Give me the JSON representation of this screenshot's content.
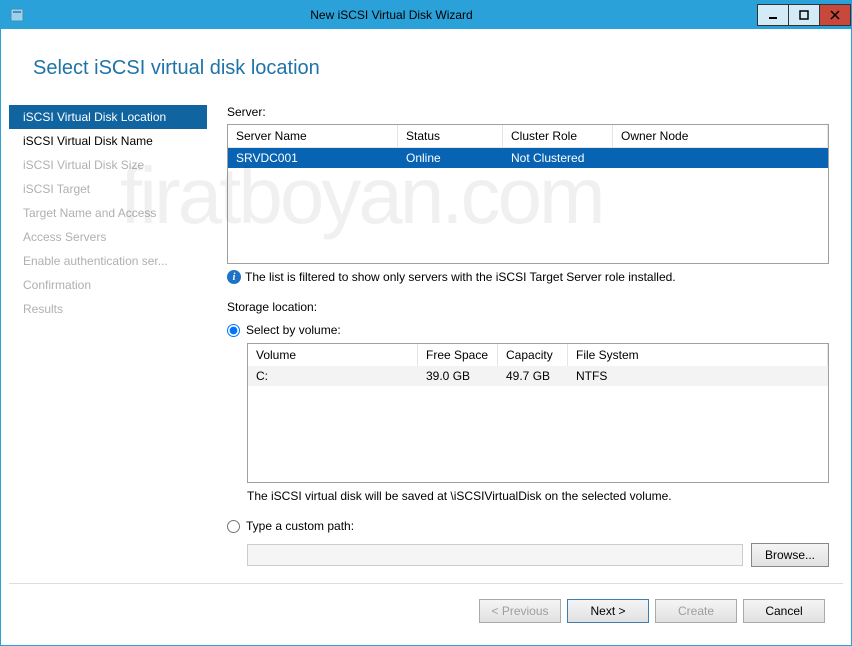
{
  "window": {
    "title": "New iSCSI Virtual Disk Wizard"
  },
  "heading": "Select iSCSI virtual disk location",
  "sidebar": {
    "items": [
      {
        "label": "iSCSI Virtual Disk Location",
        "state": "selected"
      },
      {
        "label": "iSCSI Virtual Disk Name",
        "state": "enabled"
      },
      {
        "label": "iSCSI Virtual Disk Size",
        "state": "disabled"
      },
      {
        "label": "iSCSI Target",
        "state": "disabled"
      },
      {
        "label": "Target Name and Access",
        "state": "disabled"
      },
      {
        "label": "Access Servers",
        "state": "disabled"
      },
      {
        "label": "Enable authentication ser...",
        "state": "disabled"
      },
      {
        "label": "Confirmation",
        "state": "disabled"
      },
      {
        "label": "Results",
        "state": "disabled"
      }
    ]
  },
  "server": {
    "label": "Server:",
    "columns": [
      "Server Name",
      "Status",
      "Cluster Role",
      "Owner Node"
    ],
    "rows": [
      {
        "name": "SRVDC001",
        "status": "Online",
        "role": "Not Clustered",
        "owner": ""
      }
    ],
    "info": "The list is filtered to show only servers with the iSCSI Target Server role installed."
  },
  "storage": {
    "label": "Storage location:",
    "option_volume": "Select by volume:",
    "option_path": "Type a custom path:",
    "volume_columns": [
      "Volume",
      "Free Space",
      "Capacity",
      "File System"
    ],
    "volume_rows": [
      {
        "volume": "C:",
        "free": "39.0 GB",
        "capacity": "49.7 GB",
        "fs": "NTFS"
      }
    ],
    "saved_note": "The iSCSI virtual disk will be saved at \\iSCSIVirtualDisk on the selected volume.",
    "path_value": "",
    "browse_label": "Browse..."
  },
  "footer": {
    "previous": "< Previous",
    "next": "Next >",
    "create": "Create",
    "cancel": "Cancel"
  },
  "watermark": "firatboyan.com"
}
